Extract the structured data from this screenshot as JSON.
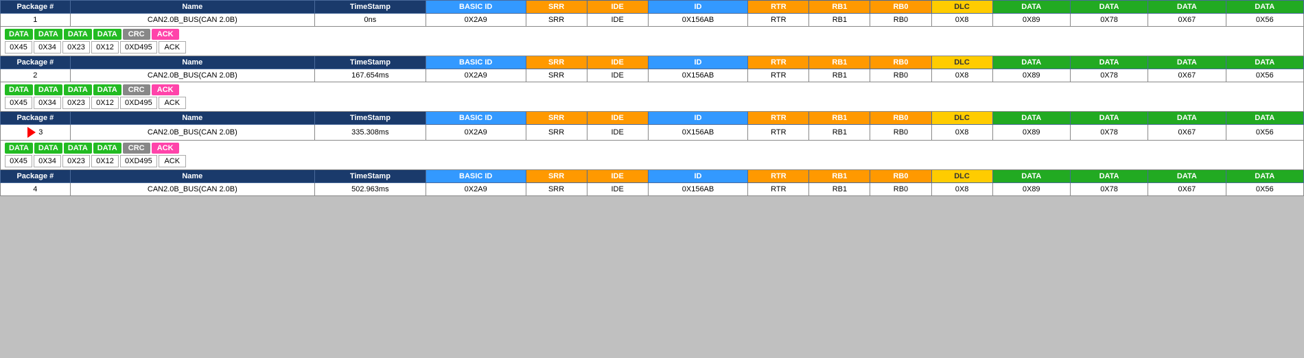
{
  "headers": {
    "col_pkg": "Package #",
    "col_name": "Name",
    "col_ts": "TimeStamp",
    "col_basic_id": "BASIC ID",
    "col_srr": "SRR",
    "col_ide": "IDE",
    "col_id": "ID",
    "col_rtr": "RTR",
    "col_rb1": "RB1",
    "col_rb0": "RB0",
    "col_dlc": "DLC",
    "col_data1": "DATA",
    "col_data2": "DATA",
    "col_data3": "DATA",
    "col_data4": "DATA"
  },
  "packages": [
    {
      "pkg_num": "1",
      "name": "CAN2.0B_BUS(CAN 2.0B)",
      "timestamp": "0ns",
      "basic_id": "0X2A9",
      "srr": "SRR",
      "ide": "IDE",
      "id": "0X156AB",
      "rtr": "RTR",
      "rb1": "RB1",
      "rb0": "RB0",
      "dlc": "0X8",
      "data1": "0X89",
      "data2": "0X78",
      "data3": "0X67",
      "data4": "0X56",
      "seg_labels": [
        "DATA",
        "DATA",
        "DATA",
        "DATA",
        "CRC",
        "ACK"
      ],
      "seg_values": [
        "0X45",
        "0X34",
        "0X23",
        "0X12",
        "0XD495",
        "ACK"
      ],
      "seg_colors": [
        "green",
        "green",
        "green",
        "green",
        "gray",
        "pink"
      ],
      "has_arrow": false
    },
    {
      "pkg_num": "2",
      "name": "CAN2.0B_BUS(CAN 2.0B)",
      "timestamp": "167.654ms",
      "basic_id": "0X2A9",
      "srr": "SRR",
      "ide": "IDE",
      "id": "0X156AB",
      "rtr": "RTR",
      "rb1": "RB1",
      "rb0": "RB0",
      "dlc": "0X8",
      "data1": "0X89",
      "data2": "0X78",
      "data3": "0X67",
      "data4": "0X56",
      "seg_labels": [
        "DATA",
        "DATA",
        "DATA",
        "DATA",
        "CRC",
        "ACK"
      ],
      "seg_values": [
        "0X45",
        "0X34",
        "0X23",
        "0X12",
        "0XD495",
        "ACK"
      ],
      "seg_colors": [
        "green",
        "green",
        "green",
        "green",
        "gray",
        "pink"
      ],
      "has_arrow": false
    },
    {
      "pkg_num": "3",
      "name": "CAN2.0B_BUS(CAN 2.0B)",
      "timestamp": "335.308ms",
      "basic_id": "0X2A9",
      "srr": "SRR",
      "ide": "IDE",
      "id": "0X156AB",
      "rtr": "RTR",
      "rb1": "RB1",
      "rb0": "RB0",
      "dlc": "0X8",
      "data1": "0X89",
      "data2": "0X78",
      "data3": "0X67",
      "data4": "0X56",
      "seg_labels": [
        "DATA",
        "DATA",
        "DATA",
        "DATA",
        "CRC",
        "ACK"
      ],
      "seg_values": [
        "0X45",
        "0X34",
        "0X23",
        "0X12",
        "0XD495",
        "ACK"
      ],
      "seg_colors": [
        "green",
        "green",
        "green",
        "green",
        "gray",
        "pink"
      ],
      "has_arrow": true
    },
    {
      "pkg_num": "4",
      "name": "CAN2.0B_BUS(CAN 2.0B)",
      "timestamp": "502.963ms",
      "basic_id": "0X2A9",
      "srr": "SRR",
      "ide": "IDE",
      "id": "0X156AB",
      "rtr": "RTR",
      "rb1": "RB1",
      "rb0": "RB0",
      "dlc": "0X8",
      "data1": "0X89",
      "data2": "0X78",
      "data3": "0X67",
      "data4": "0X56",
      "seg_labels": [],
      "seg_values": [],
      "seg_colors": [],
      "has_arrow": false
    }
  ]
}
